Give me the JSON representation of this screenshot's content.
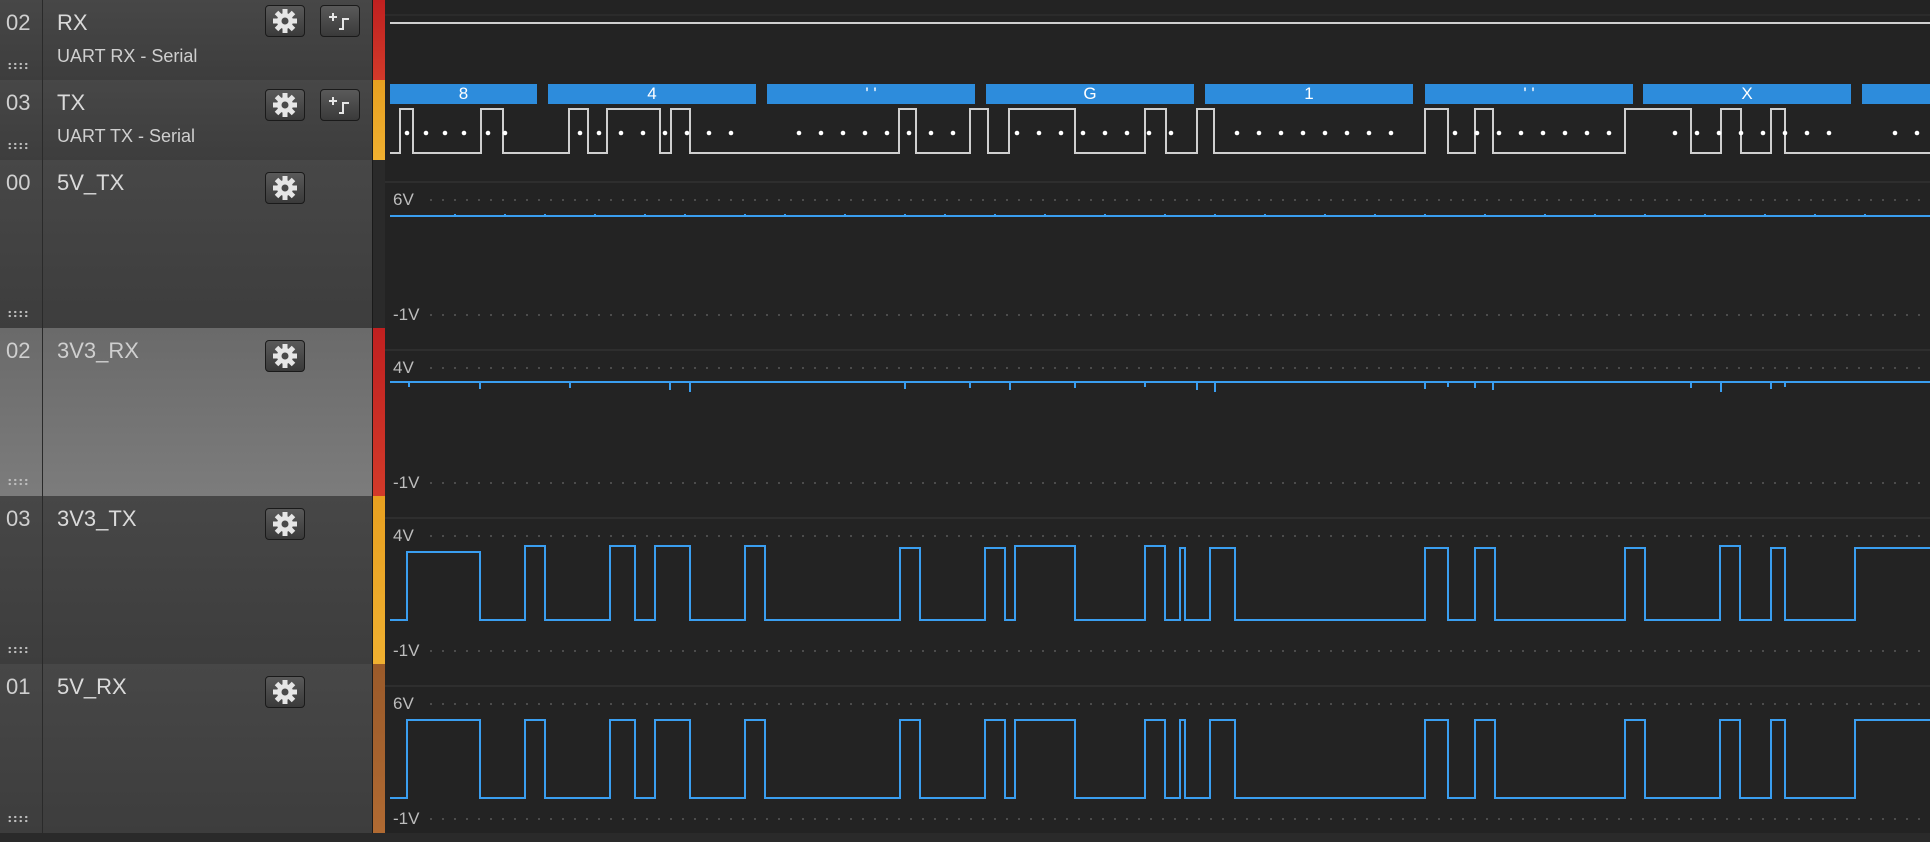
{
  "channels": [
    {
      "id": "rx-uart",
      "num": "02",
      "name": "RX",
      "sub": "UART RX - Serial",
      "type": "digital",
      "accent": "#d22a2a",
      "has_analyzer_btn": true,
      "selected": false
    },
    {
      "id": "tx-uart",
      "num": "03",
      "name": "TX",
      "sub": "UART TX - Serial",
      "type": "digital",
      "accent": "#f0a020",
      "has_analyzer_btn": true,
      "selected": false
    },
    {
      "id": "5v-tx",
      "num": "00",
      "name": "5V_TX",
      "type": "analog",
      "accent": "#222222",
      "max": "6V",
      "min": "-1V",
      "selected": false
    },
    {
      "id": "3v3-rx",
      "num": "02",
      "name": "3V3_RX",
      "type": "analog",
      "accent": "#d22a2a",
      "max": "4V",
      "min": "-1V",
      "selected": true
    },
    {
      "id": "3v3-tx",
      "num": "03",
      "name": "3V3_TX",
      "type": "analog",
      "accent": "#f0a020",
      "max": "4V",
      "min": "-1V",
      "selected": false
    },
    {
      "id": "5v-rx",
      "num": "01",
      "name": "5V_RX",
      "type": "analog",
      "accent": "#9a5a2a",
      "max": "6V",
      "min": "-1V",
      "selected": false
    }
  ],
  "decoded": [
    "8",
    "4",
    "' '",
    "G",
    "1",
    "' '",
    "X"
  ],
  "colors": {
    "signal": "#3a9ef0",
    "decode": "#2d8cdc",
    "digital_line": "#cfcfcf"
  }
}
